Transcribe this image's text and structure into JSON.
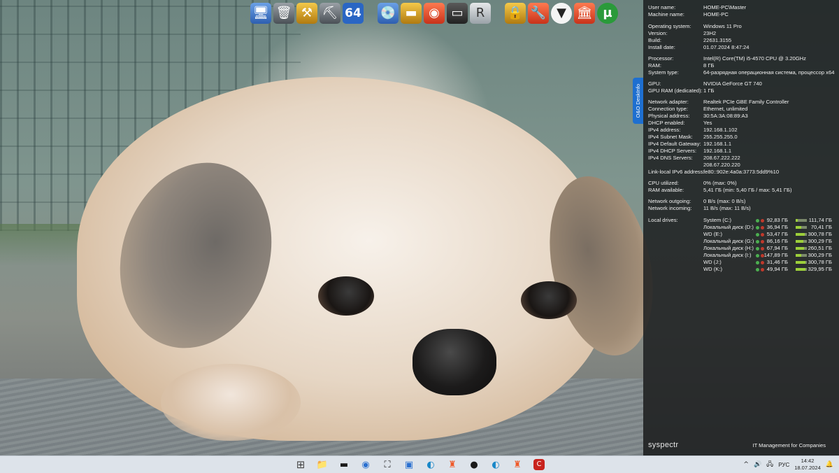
{
  "dock": {
    "icons": [
      {
        "name": "network-computer-icon",
        "glyph": "🖥"
      },
      {
        "name": "recycle-bin-icon",
        "glyph": "🗑"
      },
      {
        "name": "tools-icon",
        "glyph": "⚒"
      },
      {
        "name": "utilities-icon",
        "glyph": "⛏"
      },
      {
        "name": "aida64-icon",
        "glyph": "64"
      },
      {
        "name": "disk-drive-icon",
        "glyph": "💿"
      },
      {
        "name": "hard-drive-icon",
        "glyph": "▬"
      },
      {
        "name": "eye-app-icon",
        "glyph": "◉"
      },
      {
        "name": "memory-chip-icon",
        "glyph": "▭"
      },
      {
        "name": "revo-uninstaller-icon",
        "glyph": "R"
      },
      {
        "name": "lock-settings-icon",
        "glyph": "🔒"
      },
      {
        "name": "tools-fox-icon",
        "glyph": "🔧"
      },
      {
        "name": "fox-mask-icon",
        "glyph": "▼"
      },
      {
        "name": "colosseum-icon",
        "glyph": "🏛"
      },
      {
        "name": "utorrent-icon",
        "glyph": "µ"
      }
    ]
  },
  "side_tab": {
    "label": "O&O DeskInfo"
  },
  "info": {
    "rows": [
      {
        "k": "User name:",
        "v": "HOME-PC\\Master"
      },
      {
        "k": "Machine name:",
        "v": "HOME-PC"
      },
      {
        "k": "Operating system:",
        "v": "Windows 11 Pro"
      },
      {
        "k": "Version:",
        "v": "23H2"
      },
      {
        "k": "Build:",
        "v": "22631.3155"
      },
      {
        "k": "Install date:",
        "v": "01.07.2024 8:47:24"
      },
      {
        "k": "Processor:",
        "v": "Intel(R) Core(TM) i5-4570 CPU @ 3.20GHz"
      },
      {
        "k": "RAM:",
        "v": "8 ГБ"
      },
      {
        "k": "System type:",
        "v": "64-разрядная операционная система, процессор x64"
      },
      {
        "k": "GPU:",
        "v": "NVIDIA GeForce GT 740"
      },
      {
        "k": "GPU RAM (dedicated):",
        "v": "1 ГБ"
      },
      {
        "k": "Network adapter:",
        "v": "Realtek PCIe GBE Family Controller"
      },
      {
        "k": "Connection type:",
        "v": "Ethernet, unlimited"
      },
      {
        "k": "Physical address:",
        "v": "30:5A:3A:08:89:A3"
      },
      {
        "k": "DHCP enabled:",
        "v": "Yes"
      },
      {
        "k": "IPv4 address:",
        "v": "192.168.1.102"
      },
      {
        "k": "IPv4 Subnet Mask:",
        "v": "255.255.255.0"
      },
      {
        "k": "IPv4 Default Gateway:",
        "v": "192.168.1.1"
      },
      {
        "k": "IPv4 DHCP Servers:",
        "v": "192.168.1.1"
      },
      {
        "k": "IPv4 DNS Servers:",
        "v": "208.67.222.222"
      },
      {
        "k": "",
        "v": "208.67.220.220"
      },
      {
        "k": "Link-local IPv6 address:",
        "v": "fe80::902e:4a0a:3773:5dd9%10"
      },
      {
        "k": "CPU utilized:",
        "v": "0% (max: 0%)"
      },
      {
        "k": "RAM available:",
        "v": "5,41 ГБ (min: 5,40 ГБ / max: 5,41 ГБ)"
      },
      {
        "k": "Network outgoing:",
        "v": "0 B/s (max: 0 B/s)"
      },
      {
        "k": "Network incoming:",
        "v": "11 B/s (max: 11 B/s)"
      }
    ],
    "drives_label": "Local drives:",
    "drives": [
      {
        "name": "System (C:)",
        "free": "92,83 ГБ",
        "total": "111,74 ГБ",
        "used_fraction": 0.17
      },
      {
        "name": "Локальный диск (D:)",
        "free": "36,94 ГБ",
        "total": "70,41 ГБ",
        "used_fraction": 0.48
      },
      {
        "name": "WD (E:)",
        "free": "53,47 ГБ",
        "total": "300,78 ГБ",
        "used_fraction": 0.82
      },
      {
        "name": "Локальный диск (G:)",
        "free": "86,16 ГБ",
        "total": "300,29 ГБ",
        "used_fraction": 0.71
      },
      {
        "name": "Локальный диск (H:)",
        "free": "67,94 ГБ",
        "total": "260,51 ГБ",
        "used_fraction": 0.74
      },
      {
        "name": "Локальный диск (I:)",
        "free": "147,89 ГБ",
        "total": "300,29 ГБ",
        "used_fraction": 0.51
      },
      {
        "name": "WD (J:)",
        "free": "31,46 ГБ",
        "total": "300,78 ГБ",
        "used_fraction": 0.9
      },
      {
        "name": "WD (K:)",
        "free": "49,94 ГБ",
        "total": "329,95 ГБ",
        "used_fraction": 0.85
      }
    ]
  },
  "footer": {
    "brand": "syspectr",
    "tagline": "IT Management for Companies"
  },
  "taskbar": {
    "icons": [
      {
        "name": "start-button-icon",
        "glyph": "⊞",
        "cls": "tb-win"
      },
      {
        "name": "file-explorer-icon",
        "glyph": "📁",
        "cls": "tb-folder"
      },
      {
        "name": "drive-app-icon",
        "glyph": "▬",
        "cls": ""
      },
      {
        "name": "obs-icon",
        "glyph": "◉",
        "cls": "tb-blue"
      },
      {
        "name": "network-app-icon",
        "glyph": "⛶",
        "cls": ""
      },
      {
        "name": "image-viewer-icon",
        "glyph": "▣",
        "cls": "tb-blue"
      },
      {
        "name": "edge-icon",
        "glyph": "◐",
        "cls": "tb-edge"
      },
      {
        "name": "brave-icon",
        "glyph": "♜",
        "cls": "tb-brave"
      },
      {
        "name": "keyhole-app-icon",
        "glyph": "●",
        "cls": ""
      },
      {
        "name": "edge-beta-icon",
        "glyph": "◐",
        "cls": "tb-edge"
      },
      {
        "name": "brave-beta-icon",
        "glyph": "♜",
        "cls": "tb-brave"
      },
      {
        "name": "red-app-icon",
        "glyph": "C",
        "cls": "tb-red"
      }
    ],
    "tray": {
      "chevron": "^",
      "volume": "🔊",
      "network": "🖧",
      "lang": "РУС",
      "time": "14:42",
      "date": "18.07.2024",
      "bell": "🔔"
    }
  }
}
